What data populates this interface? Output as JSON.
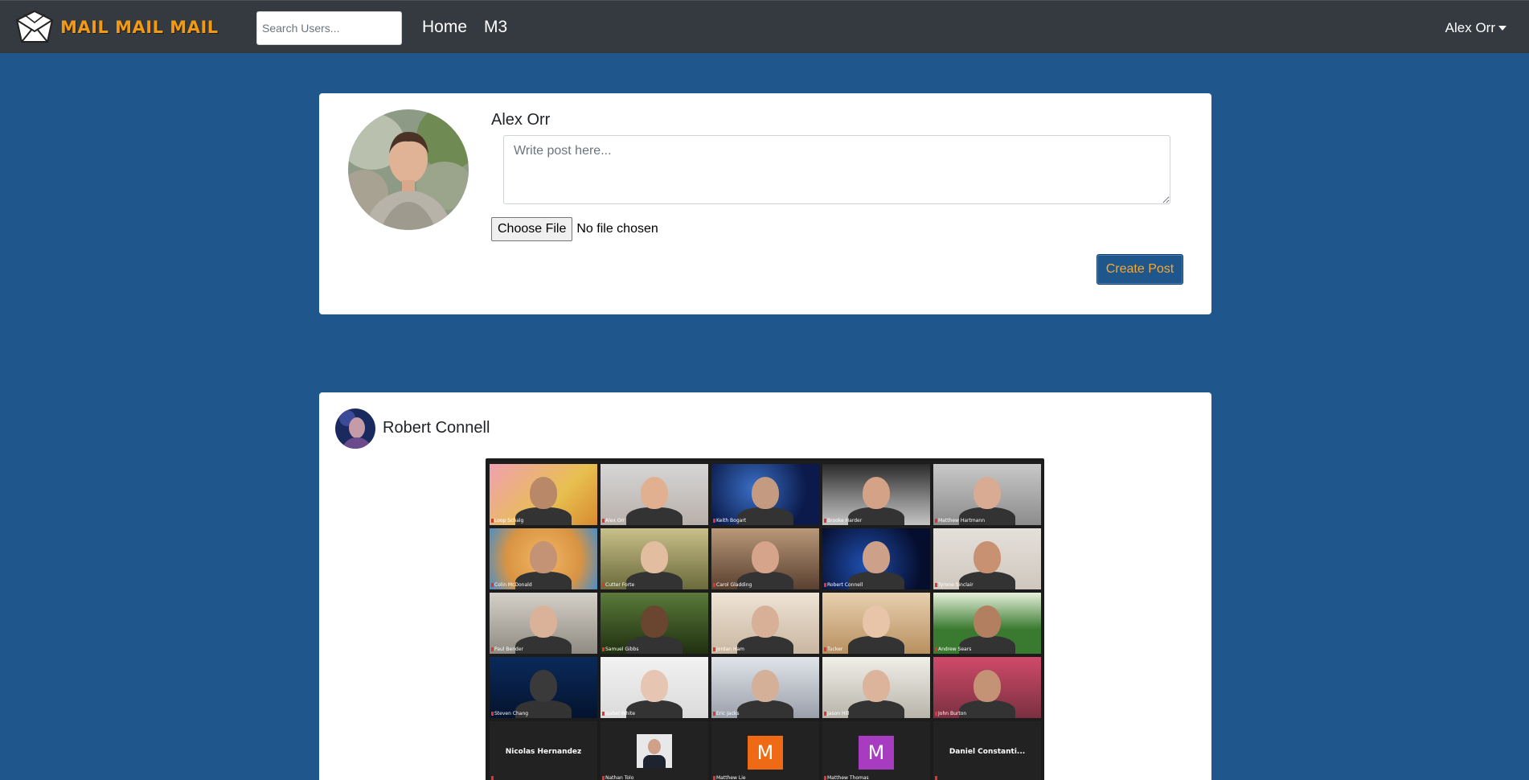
{
  "nav": {
    "brand": "MAIL MAIL MAIL",
    "search_placeholder": "Search Users...",
    "links": [
      "Home",
      "M3"
    ],
    "user": "Alex Orr"
  },
  "composer": {
    "name": "Alex Orr",
    "post_placeholder": "Write post here...",
    "choose_file_label": "Choose File",
    "file_status": "No file chosen",
    "submit_label": "Create Post"
  },
  "feed": {
    "posts": [
      {
        "author": "Robert Connell",
        "image": {
          "participants": [
            "Loop Schalg",
            "Alex Orr",
            "Keith Bogart",
            "Brooke Harder",
            "Matthew Hartmann",
            "Colin McDonald",
            "Cutter Forte",
            "Carol Gladding",
            "Robert Connell",
            "Tyrone Sinclair",
            "Paul Bender",
            "Samuel Gibbs",
            "Jordan Ham",
            "Tucker",
            "Andrew Sears",
            "Steven Chang",
            "Isabel White",
            "Eric Jacks",
            "Jason Hill",
            "John Burton"
          ],
          "name_tiles": [
            {
              "label": "Nicolas Hernandez",
              "caption": ""
            },
            {
              "label": "",
              "caption": "Nathan Tolo"
            },
            {
              "label": "",
              "letter": "M",
              "caption": "Matthew Lie"
            },
            {
              "label": "",
              "letter": "M",
              "caption": "Matthew Thomas"
            },
            {
              "label": "Daniel  Constanti...",
              "caption": ""
            }
          ]
        }
      }
    ]
  },
  "colors": {
    "page_bg": "#1f578d",
    "navbar_bg": "#343a40",
    "brand_orange": "#f29a12",
    "button_bg": "#1f578d",
    "button_text": "#f4a733",
    "active_speaker": "#b8e34a"
  }
}
